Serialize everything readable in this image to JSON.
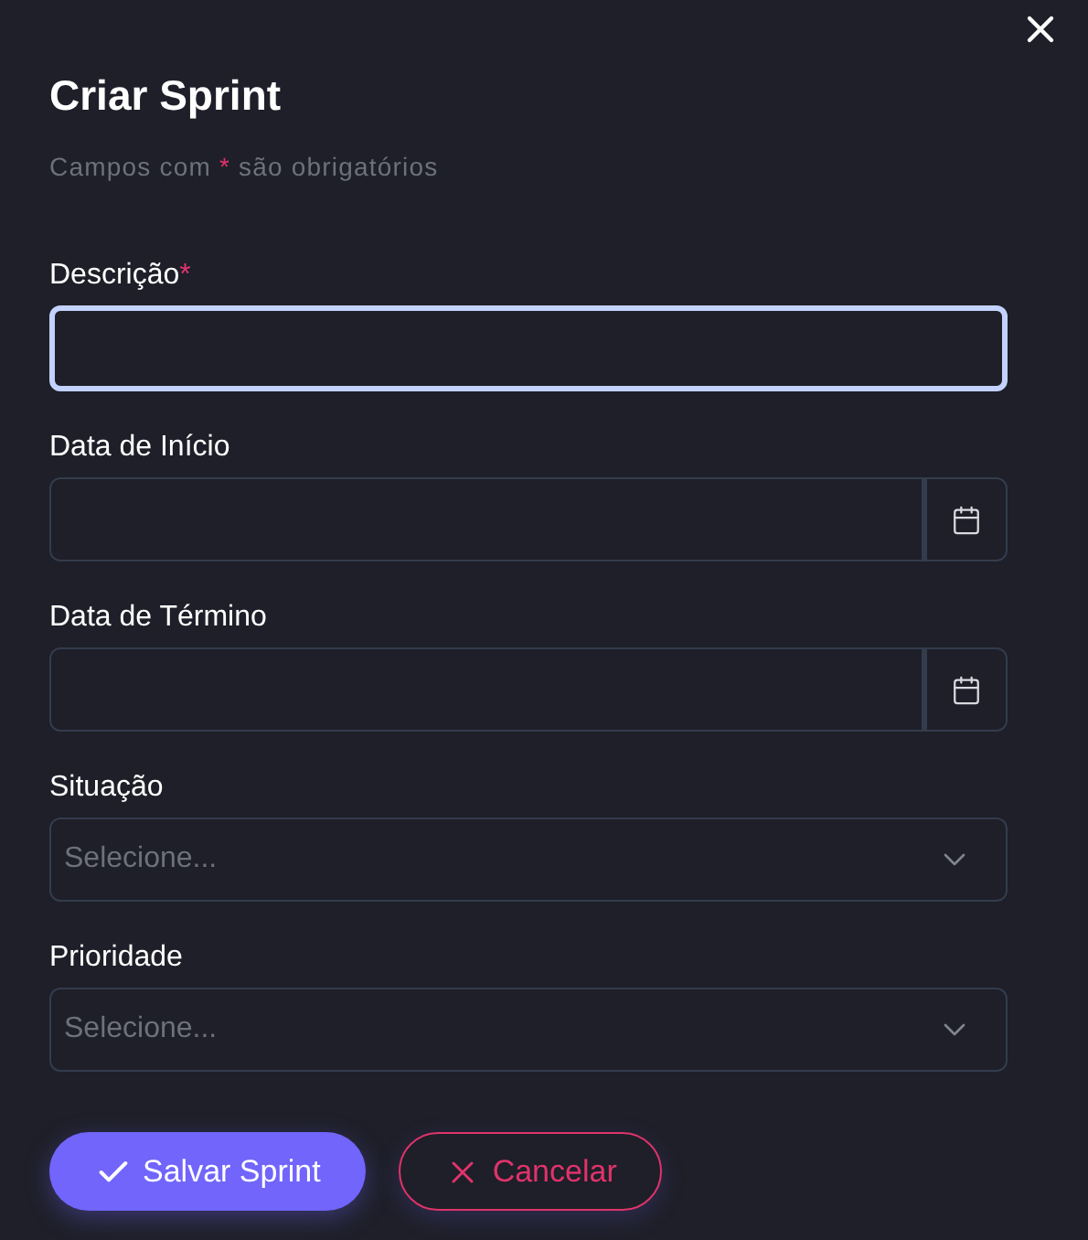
{
  "dialog": {
    "title": "Criar Sprint",
    "subtitle": {
      "before": "Campos com",
      "mark": "*",
      "after": "são obrigatórios"
    }
  },
  "fields": [
    {
      "kind": "text",
      "label": "Descrição",
      "required": true,
      "focused": true
    },
    {
      "kind": "date",
      "label": "Data de Início",
      "required": false,
      "focused": false
    },
    {
      "kind": "date",
      "label": "Data de Término",
      "required": false,
      "focused": false
    },
    {
      "kind": "select",
      "label": "Situação",
      "required": false,
      "focused": false,
      "placeholder": "Selecione..."
    },
    {
      "kind": "select",
      "label": "Prioridade",
      "required": false,
      "focused": false,
      "placeholder": "Selecione..."
    }
  ],
  "buttons": [
    {
      "kind": "primary",
      "label": "Salvar Sprint"
    },
    {
      "kind": "secondary",
      "label": "Cancelar"
    }
  ]
}
